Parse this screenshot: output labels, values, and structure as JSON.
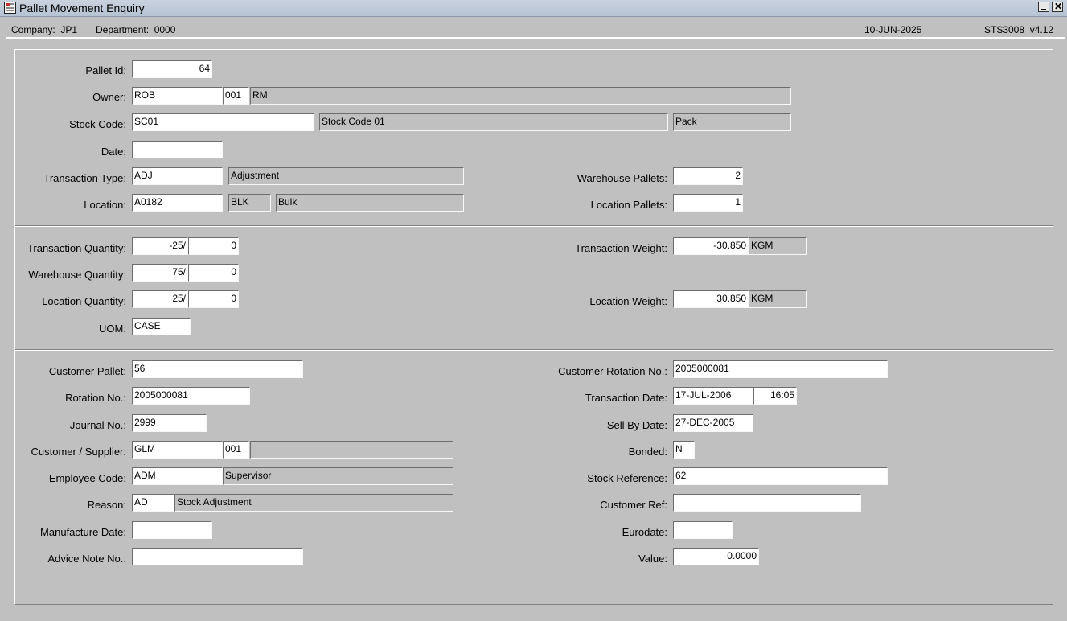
{
  "window": {
    "title": "Pallet Movement Enquiry",
    "icon": "form-app-icon"
  },
  "header": {
    "company": "Company:  JP1",
    "department": "Department:  0000",
    "date": "10-JUN-2025",
    "program": "STS3008  v4.12"
  },
  "section1": {
    "pallet_id_label": "Pallet Id:",
    "pallet_id": "64",
    "owner_label": "Owner:",
    "owner_code": "ROB",
    "owner_sub": "001",
    "owner_name": "RM",
    "stock_code_label": "Stock Code:",
    "stock_code": "SC01",
    "stock_desc": "Stock Code 01",
    "stock_pack": "Pack",
    "date_label": "Date:",
    "date": "",
    "trans_type_label": "Transaction Type:",
    "trans_type": "ADJ",
    "trans_type_desc": "Adjustment",
    "location_label": "Location:",
    "location": "A0182",
    "location_type": "BLK",
    "location_desc": "Bulk",
    "warehouse_pallets_label": "Warehouse Pallets:",
    "warehouse_pallets": "2",
    "location_pallets_label": "Location Pallets:",
    "location_pallets": "1"
  },
  "section2": {
    "trans_qty_label": "Transaction Quantity:",
    "trans_qty": "-25/",
    "trans_qty_units": "0",
    "wh_qty_label": "Warehouse Quantity:",
    "wh_qty": "75/",
    "wh_qty_units": "0",
    "loc_qty_label": "Location Quantity:",
    "loc_qty": "25/",
    "loc_qty_units": "0",
    "uom_label": "UOM:",
    "uom": "CASE",
    "trans_weight_label": "Transaction Weight:",
    "trans_weight": "-30.850",
    "trans_weight_unit": "KGM",
    "loc_weight_label": "Location Weight:",
    "loc_weight": "30.850",
    "loc_weight_unit": "KGM"
  },
  "section3": {
    "customer_pallet_label": "Customer Pallet:",
    "customer_pallet": "56",
    "rotation_no_label": "Rotation No.:",
    "rotation_no": "2005000081",
    "journal_no_label": "Journal No.:",
    "journal_no": "2999",
    "cust_supp_label": "Customer / Supplier:",
    "cust_supp": "GLM",
    "cust_supp_sub": "001",
    "cust_supp_name": "",
    "employee_label": "Employee Code:",
    "employee_code": "ADM",
    "employee_name": "Supervisor",
    "reason_label": "Reason:",
    "reason_code": "AD",
    "reason_desc": "Stock Adjustment",
    "manufacture_date_label": "Manufacture Date:",
    "manufacture_date": "",
    "advice_note_label": "Advice Note No.:",
    "advice_note": "",
    "cust_rotation_label": "Customer Rotation No.:",
    "cust_rotation": "2005000081",
    "trans_date_label": "Transaction Date:",
    "trans_date": "17-JUL-2006",
    "trans_time": "16:05",
    "sell_by_label": "Sell By Date:",
    "sell_by": "27-DEC-2005",
    "bonded_label": "Bonded:",
    "bonded": "N",
    "stock_ref_label": "Stock Reference:",
    "stock_ref": "62",
    "customer_ref_label": "Customer Ref:",
    "customer_ref": "",
    "eurodate_label": "Eurodate:",
    "eurodate": "",
    "value_label": "Value:",
    "value": "0.0000"
  }
}
